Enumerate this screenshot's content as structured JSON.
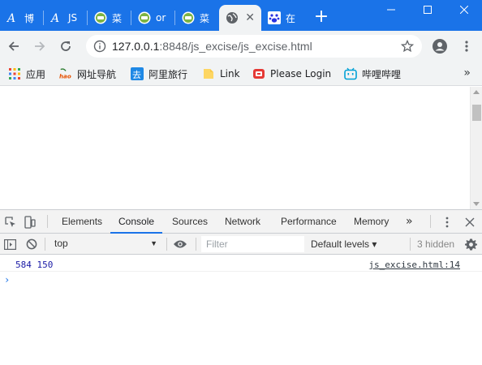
{
  "tabs": [
    {
      "title": "博",
      "icon": "script-a-icon",
      "active": false
    },
    {
      "title": "JS",
      "icon": "script-a-icon",
      "active": false
    },
    {
      "title": "菜",
      "icon": "runoob-icon",
      "active": false
    },
    {
      "title": "or",
      "icon": "runoob-icon",
      "active": false
    },
    {
      "title": "菜",
      "icon": "runoob-icon",
      "active": false
    },
    {
      "title": "",
      "icon": "globe-icon",
      "active": true,
      "close": "✕"
    },
    {
      "title": "在",
      "icon": "baidu-paw-icon",
      "active": false
    }
  ],
  "new_tab_label": "+",
  "address": {
    "host": "127.0.0.1",
    "path": ":8848/js_excise/js_excise.html"
  },
  "bookmarks": [
    {
      "label": "应用",
      "icon": "apps-grid-icon"
    },
    {
      "label": "网址导航",
      "icon": "hao-icon"
    },
    {
      "label": "阿里旅行",
      "icon": "alitrip-icon"
    },
    {
      "label": "Link",
      "icon": "folder-icon"
    },
    {
      "label": "Please Login",
      "icon": "login-icon"
    },
    {
      "label": "哔哩哔哩",
      "icon": "bilibili-icon"
    }
  ],
  "bookmarks_more": "»",
  "devtools": {
    "tabs": [
      "Elements",
      "Console",
      "Sources",
      "Network",
      "Performance",
      "Memory"
    ],
    "active_tab": "Console",
    "more": "»",
    "context": "top",
    "filter_placeholder": "Filter",
    "levels": "Default levels ▾",
    "hidden": "3 hidden",
    "log": {
      "message": "584 150",
      "source": "js_excise.html:14"
    },
    "prompt": "›"
  },
  "colors": {
    "accent": "#1a73e8",
    "log_blue": "#1a1aa6",
    "toolbar_bg": "#f1f3f4"
  }
}
